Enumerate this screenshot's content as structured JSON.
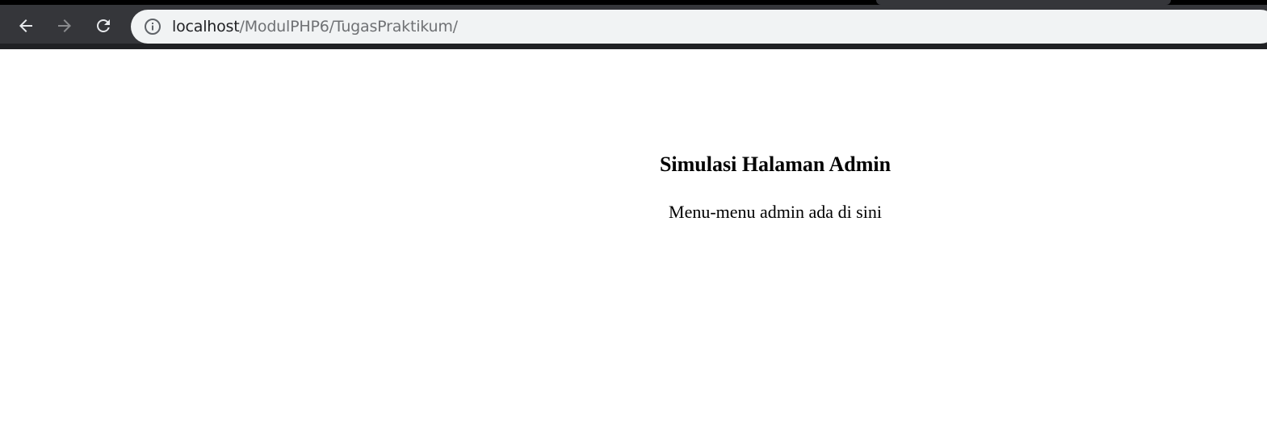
{
  "browser": {
    "url_host": "localhost",
    "url_path": "/ModulPHP6/TugasPraktikum/",
    "back_enabled": true,
    "forward_enabled": false,
    "icons": {
      "back": "arrow-left-icon",
      "forward": "arrow-right-icon",
      "reload": "reload-icon",
      "site_info": "info-icon"
    },
    "colors": {
      "frame": "#35363a",
      "omnibox": "#f1f3f4",
      "url_host": "#202124",
      "url_path": "#6f7174"
    }
  },
  "page": {
    "heading": "Simulasi Halaman Admin",
    "text": "Menu-menu admin ada di sini"
  }
}
